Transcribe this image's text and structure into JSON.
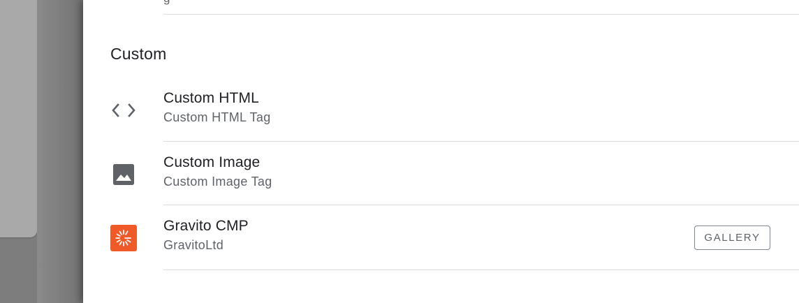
{
  "top_partial_text": "g",
  "section": {
    "title": "Custom"
  },
  "items": [
    {
      "title": "Custom HTML",
      "subtitle": "Custom HTML Tag",
      "icon": "code-icon"
    },
    {
      "title": "Custom Image",
      "subtitle": "Custom Image Tag",
      "icon": "image-icon"
    },
    {
      "title": "Gravito CMP",
      "subtitle": "GravitoLtd",
      "icon": "gravito-logo-icon",
      "badge": "GALLERY"
    }
  ],
  "colors": {
    "icon_gray": "#5f6368",
    "gravito_orange": "#f05a28",
    "divider": "#dadce0"
  }
}
